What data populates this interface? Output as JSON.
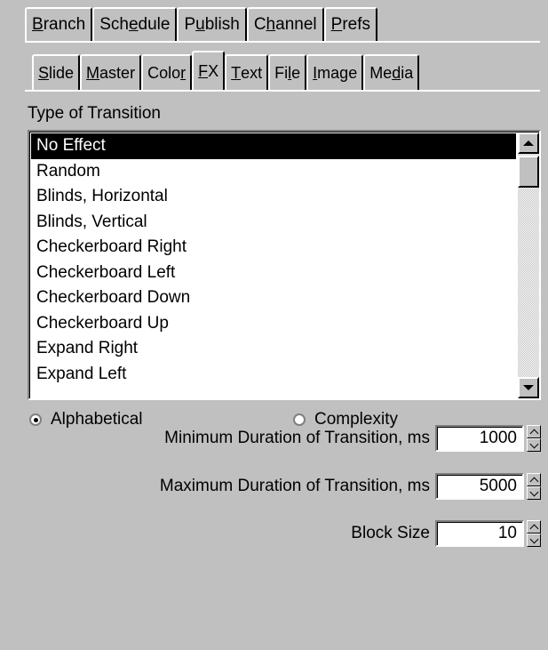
{
  "tabs_row1": [
    {
      "pre": "",
      "key": "B",
      "post": "ranch"
    },
    {
      "pre": "Sch",
      "key": "e",
      "post": "dule"
    },
    {
      "pre": "P",
      "key": "u",
      "post": "blish"
    },
    {
      "pre": "C",
      "key": "h",
      "post": "annel"
    },
    {
      "pre": "",
      "key": "P",
      "post": "refs"
    }
  ],
  "tabs_row2": [
    {
      "pre": "",
      "key": "S",
      "post": "lide"
    },
    {
      "pre": "",
      "key": "M",
      "post": "aster"
    },
    {
      "pre": "Colo",
      "key": "r",
      "post": ""
    },
    {
      "pre": "",
      "key": "F",
      "post": "X"
    },
    {
      "pre": "",
      "key": "T",
      "post": "ext"
    },
    {
      "pre": "Fi",
      "key": "l",
      "post": "e"
    },
    {
      "pre": "",
      "key": "I",
      "post": "mage"
    },
    {
      "pre": "Me",
      "key": "d",
      "post": "ia"
    }
  ],
  "transition": {
    "label": "Type of Transition",
    "items": [
      "No Effect",
      "Random",
      "Blinds, Horizontal",
      "Blinds, Vertical",
      "Checkerboard Right",
      "Checkerboard Left",
      "Checkerboard Down",
      "Checkerboard Up",
      "Expand Right",
      "Expand Left"
    ]
  },
  "sort": {
    "alphabetical": "Alphabetical",
    "complexity": "Complexity"
  },
  "fields": {
    "min_label": "Minimum Duration of Transition, ms",
    "min_value": "1000",
    "max_label": "Maximum Duration of Transition, ms",
    "max_value": "5000",
    "block_label": "Block Size",
    "block_value": "10"
  }
}
